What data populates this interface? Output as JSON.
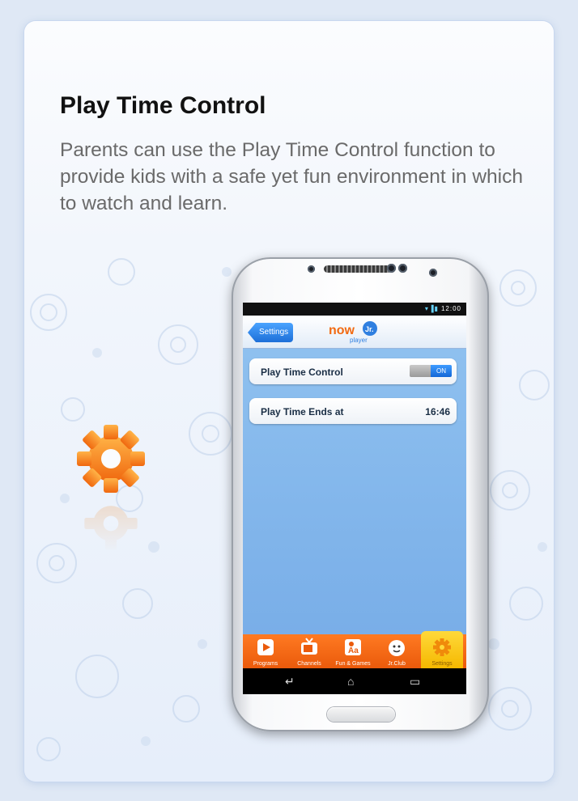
{
  "header": {
    "title": "Play Time Control",
    "description": "Parents can use the Play Time Control function to provide kids with a safe yet fun environment in which to watch and learn."
  },
  "phone": {
    "status_time": "12:00",
    "app_bar": {
      "back_label": "Settings",
      "logo_text": "now",
      "logo_badge": "Jr.",
      "logo_sub": "player"
    },
    "settings": {
      "play_time_control_label": "Play Time Control",
      "toggle_state": "ON",
      "play_time_ends_label": "Play Time Ends at",
      "play_time_ends_value": "16:46"
    },
    "tabs": [
      {
        "label": "Programs",
        "icon": "play-icon"
      },
      {
        "label": "Channels",
        "icon": "tv-icon"
      },
      {
        "label": "Fun & Games",
        "icon": "games-icon"
      },
      {
        "label": "Jr.Club",
        "icon": "mascot-icon"
      },
      {
        "label": "Settings",
        "icon": "gear-icon"
      }
    ],
    "nav": {
      "back": "back-icon",
      "home": "home-icon",
      "recent": "recent-apps-icon"
    }
  },
  "colors": {
    "accent_orange": "#f26a12",
    "tab_active": "#ffc81a",
    "app_blue": "#1d6fd8",
    "content_blue": "#84b8ec"
  }
}
